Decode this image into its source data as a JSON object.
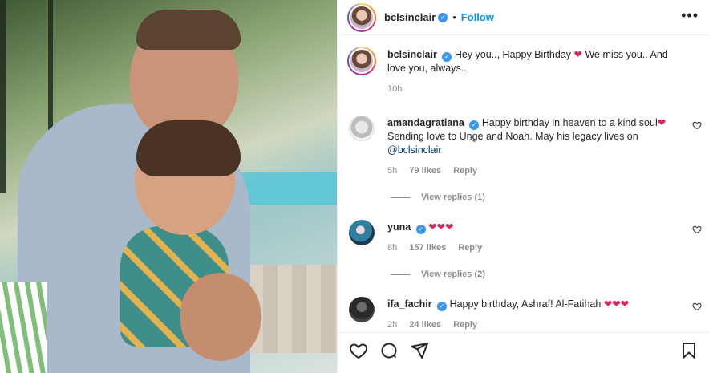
{
  "header": {
    "username": "bclsinclair",
    "separator": "•",
    "follow_label": "Follow",
    "more_label": "•••"
  },
  "caption": {
    "username": "bclsinclair",
    "text_a": "Hey you.., Happy Birthday",
    "heart": "❤",
    "text_b": "We miss you.. And love you, always..",
    "time": "10h"
  },
  "comments": [
    {
      "username": "amandagratiana",
      "text": "Happy birthday in heaven to a kind soul",
      "hearts": "❤",
      "text2": "Sending love to Unge and Noah. May his legacy lives on",
      "mention": "@bclsinclair",
      "time": "5h",
      "likes": "79 likes",
      "reply_label": "Reply",
      "view_replies": "View replies (1)"
    },
    {
      "username": "yuna",
      "text": "",
      "hearts": "❤❤❤",
      "time": "8h",
      "likes": "157 likes",
      "reply_label": "Reply",
      "view_replies": "View replies (2)"
    },
    {
      "username": "ifa_fachir",
      "text": "Happy birthday, Ashraf! Al-Fatihah",
      "hearts": "❤❤❤",
      "time": "2h",
      "likes": "24 likes",
      "reply_label": "Reply"
    }
  ],
  "icons": {
    "verified": "✓",
    "heart_color": "#e0245e",
    "accent": "#0095f6"
  }
}
